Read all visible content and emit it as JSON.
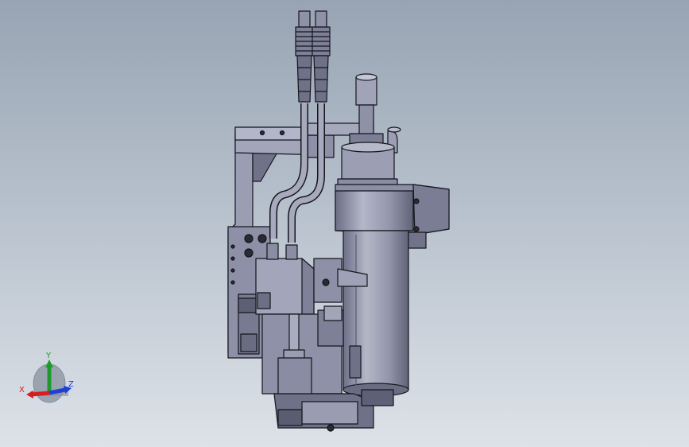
{
  "viewport": {
    "background_top": "#98a4b3",
    "background_bottom": "#dde2e8"
  },
  "model": {
    "part_fill": "#8d90a6",
    "part_fill_light": "#a9acbf",
    "part_fill_dark": "#5f6278",
    "edge_color": "#15151c"
  },
  "triad": {
    "x_label": "X",
    "y_label": "Y",
    "z_label": "Z",
    "x_color": "#d41f1f",
    "y_color": "#1c9a2a",
    "z_color": "#1f3fd4"
  }
}
